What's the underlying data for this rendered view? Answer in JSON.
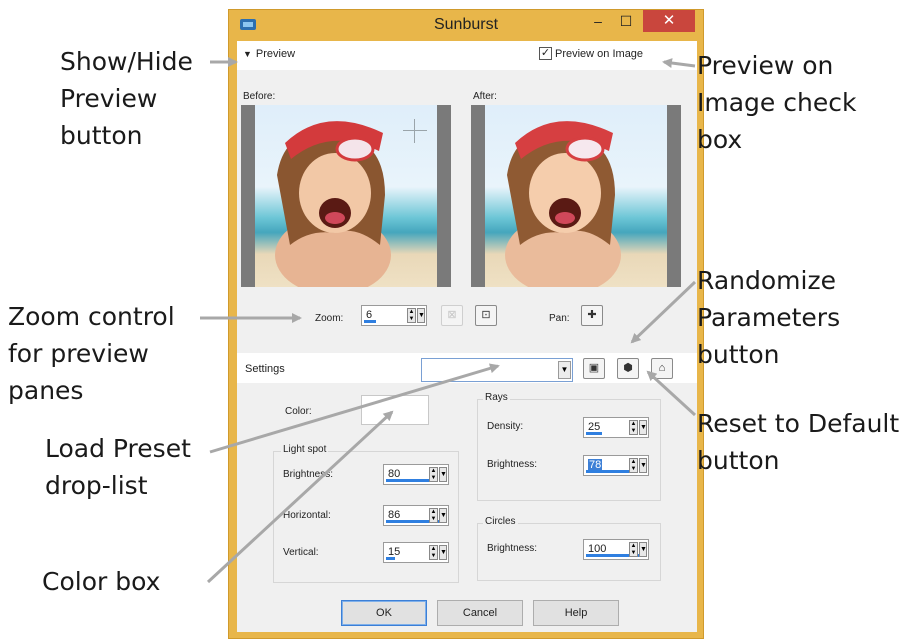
{
  "window": {
    "title": "Sunburst",
    "controls": {
      "minimize": "–",
      "maximize": "☐",
      "close": "✕"
    }
  },
  "preview": {
    "toggle_label": "Preview",
    "preview_on_image_label": "Preview on Image",
    "preview_on_image_checked": true,
    "before_label": "Before:",
    "after_label": "After:",
    "zoom_label": "Zoom:",
    "zoom_value": "6",
    "pan_label": "Pan:"
  },
  "settings": {
    "label": "Settings",
    "preset_value": ""
  },
  "params": {
    "color_label": "Color:",
    "color_value": "#ffffff",
    "light_spot": {
      "title": "Light spot",
      "brightness_label": "Brightness:",
      "brightness_value": "80",
      "horizontal_label": "Horizontal:",
      "horizontal_value": "86",
      "vertical_label": "Vertical:",
      "vertical_value": "15"
    },
    "rays": {
      "title": "Rays",
      "density_label": "Density:",
      "density_value": "25",
      "brightness_label": "Brightness:",
      "brightness_value": "78"
    },
    "circles": {
      "title": "Circles",
      "brightness_label": "Brightness:",
      "brightness_value": "100"
    }
  },
  "buttons": {
    "ok": "OK",
    "cancel": "Cancel",
    "help": "Help"
  },
  "callouts": {
    "show_hide": "Show/Hide\nPreview\nbutton",
    "preview_on_image": "Preview on\nImage check\nbox",
    "zoom": "Zoom control\nfor preview\npanes",
    "randomize": "Randomize\nParameters\nbutton",
    "load_preset": "Load Preset\ndrop-list",
    "reset": "Reset to Default\nbutton",
    "color_box": "Color box"
  },
  "colors": {
    "window_frame": "#e8b64a",
    "close_button": "#c9463d",
    "accent": "#3c7fd6",
    "arrow": "#a8a8a8"
  },
  "icons": {
    "preview_toggle": "triangle-down-icon",
    "zoom_fit": "zoom-fit-icon",
    "zoom_reset": "zoom-actual-icon",
    "pan": "pan-cross-icon",
    "save_preset": "save-preset-icon",
    "randomize": "dice-icon",
    "reset": "reset-default-icon"
  }
}
